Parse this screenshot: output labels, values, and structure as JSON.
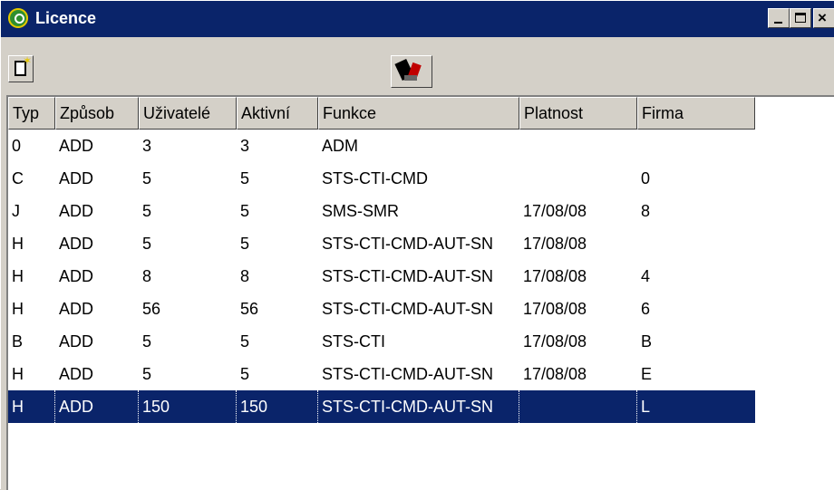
{
  "window": {
    "title": "Licence",
    "icon": "licence-app-icon",
    "controls": [
      "minimize",
      "maximize",
      "close"
    ]
  },
  "toolbar": {
    "new_icon": "new-document-icon",
    "tools_icon": "tools-icon"
  },
  "columns": [
    "Typ",
    "Způsob",
    "Uživatelé",
    "Aktivní",
    "Funkce",
    "Platnost",
    "Firma"
  ],
  "rows": [
    [
      "0",
      "ADD",
      "3",
      "3",
      "ADM",
      "",
      ""
    ],
    [
      "C",
      "ADD",
      "5",
      "5",
      "STS-CTI-CMD",
      "",
      "0"
    ],
    [
      "J",
      "ADD",
      "5",
      "5",
      "SMS-SMR",
      "17/08/08",
      "8"
    ],
    [
      "H",
      "ADD",
      "5",
      "5",
      "STS-CTI-CMD-AUT-SN",
      "17/08/08",
      ""
    ],
    [
      "H",
      "ADD",
      "8",
      "8",
      "STS-CTI-CMD-AUT-SN",
      "17/08/08",
      "4"
    ],
    [
      "H",
      "ADD",
      "56",
      "56",
      "STS-CTI-CMD-AUT-SN",
      "17/08/08",
      "6"
    ],
    [
      "B",
      "ADD",
      "5",
      "5",
      "STS-CTI",
      "17/08/08",
      "B"
    ],
    [
      "H",
      "ADD",
      "5",
      "5",
      "STS-CTI-CMD-AUT-SN",
      "17/08/08",
      "E"
    ],
    [
      "H",
      "ADD",
      "150",
      "150",
      "STS-CTI-CMD-AUT-SN",
      "",
      "L"
    ]
  ],
  "selected_row": 8,
  "colors": {
    "title_bar": "#0a246a",
    "selection": "#0a246a",
    "face": "#d4d0c8"
  }
}
